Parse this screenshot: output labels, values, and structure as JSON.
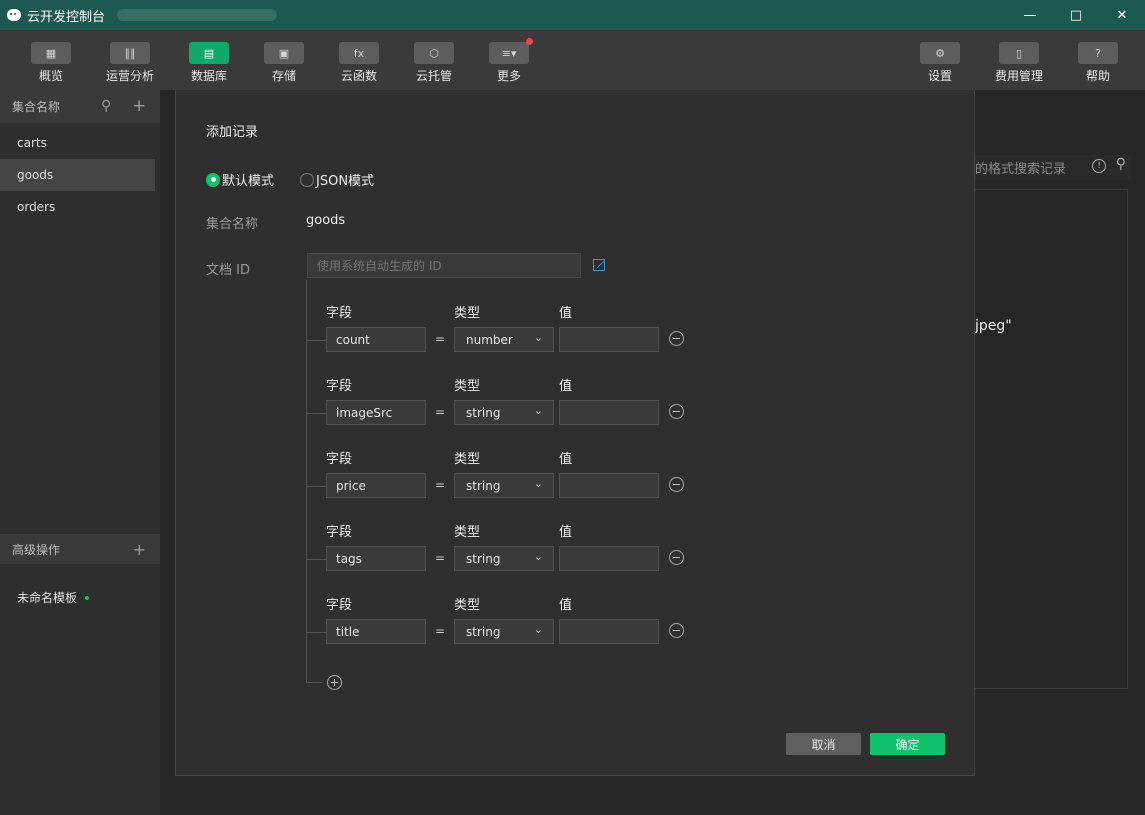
{
  "window": {
    "title": "云开发控制台"
  },
  "toolbar": {
    "left": [
      {
        "label": "概览",
        "icon": "grid-icon"
      },
      {
        "label": "运营分析",
        "icon": "bar-chart-icon"
      },
      {
        "label": "数据库",
        "icon": "database-icon",
        "active": true
      },
      {
        "label": "存储",
        "icon": "storage-icon"
      },
      {
        "label": "云函数",
        "icon": "function-icon"
      },
      {
        "label": "云托管",
        "icon": "container-icon"
      },
      {
        "label": "更多",
        "icon": "layers-icon",
        "badge": true
      }
    ],
    "right": [
      {
        "label": "设置",
        "icon": "gear-icon"
      },
      {
        "label": "费用管理",
        "icon": "billing-icon"
      },
      {
        "label": "帮助",
        "icon": "help-icon"
      }
    ]
  },
  "sidebar": {
    "header": "集合名称",
    "collections": [
      "carts",
      "goods",
      "orders"
    ],
    "selected": "goods",
    "advanced_header": "高级操作",
    "template": "未命名模板"
  },
  "background": {
    "search_placeholder": "的格式搜索记录",
    "snippet": "jpeg\""
  },
  "dialog": {
    "title": "添加记录",
    "mode_default": "默认模式",
    "mode_json": "JSON模式",
    "collection_label": "集合名称",
    "collection_value": "goods",
    "docid_label": "文档 ID",
    "docid_placeholder": "使用系统自动生成的 ID",
    "col_field": "字段",
    "col_type": "类型",
    "col_value": "值",
    "fields": [
      {
        "name": "count",
        "type": "number",
        "value": ""
      },
      {
        "name": "imageSrc",
        "type": "string",
        "value": ""
      },
      {
        "name": "price",
        "type": "string",
        "value": ""
      },
      {
        "name": "tags",
        "type": "string",
        "value": ""
      },
      {
        "name": "title",
        "type": "string",
        "value": ""
      }
    ],
    "eq": "=",
    "cancel": "取消",
    "confirm": "确定"
  },
  "colors": {
    "accent": "#11c26d",
    "titlebar": "#1c5a4f"
  }
}
